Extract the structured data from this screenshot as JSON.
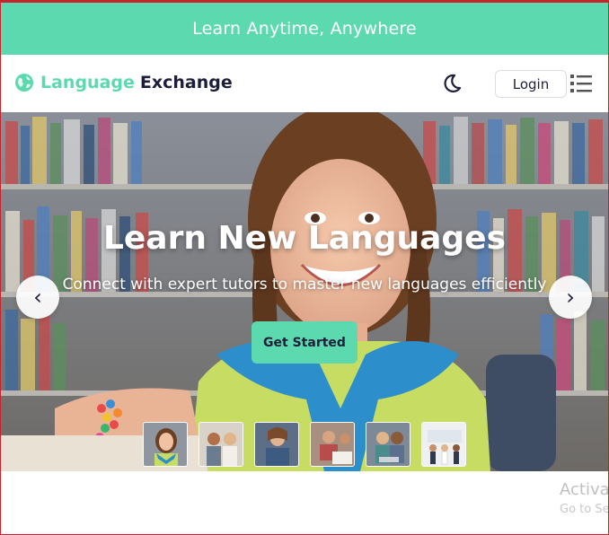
{
  "promo_banner": {
    "text": "Learn Anytime, Anywhere"
  },
  "brand": {
    "icon": "globe-icon",
    "part1": "Language",
    "part2": "Exchange",
    "accent": "#5dd9b0",
    "dark": "#1d1f3a"
  },
  "navbar": {
    "theme_icon": "moon-icon",
    "login_label": "Login",
    "menu_icon": "list-menu-icon"
  },
  "hero": {
    "title": "Learn New Languages",
    "subtitle": "Connect with expert tutors to master new languages efficiently",
    "cta_label": "Get Started",
    "prev_label": "‹",
    "next_label": "›",
    "thumbnails": [
      {
        "name": "girl-smiling"
      },
      {
        "name": "two-people"
      },
      {
        "name": "group-studying"
      },
      {
        "name": "student-writing"
      },
      {
        "name": "pair-laptop"
      },
      {
        "name": "office-team"
      }
    ]
  },
  "watermark": {
    "line1": "Activa",
    "line2": "Go to Se"
  }
}
